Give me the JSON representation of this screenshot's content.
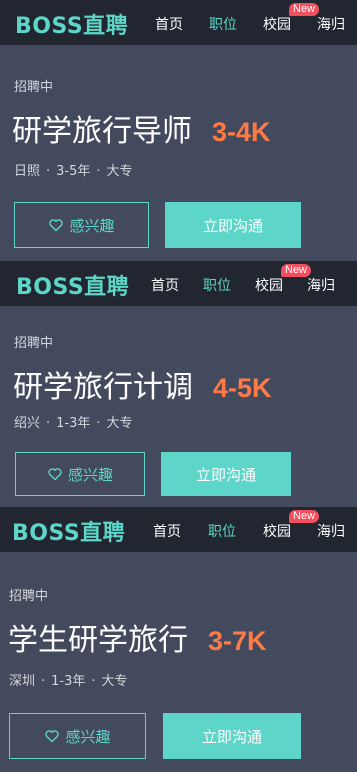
{
  "nav": {
    "logo": "BOSS直聘",
    "items": [
      "首页",
      "职位",
      "校园",
      "海归"
    ],
    "badge": "New"
  },
  "jobs": [
    {
      "status": "招聘中",
      "title": "研学旅行导师",
      "salary": "3-4K",
      "city": "日照",
      "experience": "3-5年",
      "education": "大专"
    },
    {
      "status": "招聘中",
      "title": "研学旅行计调",
      "salary": "4-5K",
      "city": "绍兴",
      "experience": "1-3年",
      "education": "大专"
    },
    {
      "status": "招聘中",
      "title": "学生研学旅行",
      "salary": "3-7K",
      "city": "深圳",
      "experience": "1-3年",
      "education": "大专"
    }
  ],
  "buttons": {
    "interest": "感兴趣",
    "chat": "立即沟通"
  },
  "colors": {
    "accent": "#5dd5c8",
    "salary": "#ff7a45",
    "badge": "#f34f5f",
    "nav_bg": "#222630",
    "card_bg": "#444a5e"
  },
  "icons": {
    "interest": "heart-icon"
  }
}
